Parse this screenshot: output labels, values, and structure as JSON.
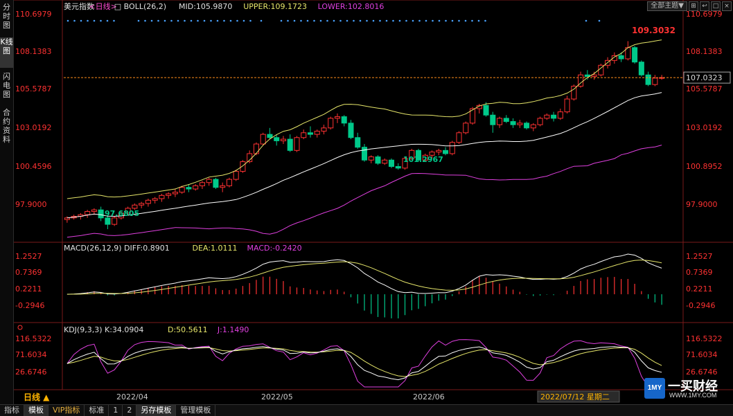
{
  "sidebar": {
    "tabs": [
      {
        "label": "分时图",
        "active": false
      },
      {
        "label": "K线图",
        "active": true
      },
      {
        "label": "闪电图",
        "active": false
      },
      {
        "label": "合约资料",
        "active": false
      }
    ]
  },
  "toolbar": {
    "theme_label": "全部主题▼",
    "icons": [
      "layout-icon",
      "back-icon",
      "minimize-icon",
      "close-icon"
    ]
  },
  "legend": {
    "instrument": "美元指数",
    "period": "<日线>",
    "boll": "BOLL(26,2)",
    "mid": "MID:105.9870",
    "upper": "UPPER:109.1723",
    "lower": "LOWER:102.8016",
    "macd_name": "MACD(26,12,9)",
    "diff": "DIFF:0.8901",
    "dea": "DEA:1.0111",
    "macd": "MACD:-0.2420",
    "kdj_name": "KDJ(9,3,3)",
    "k": "K:34.0904",
    "d": "D:50.5611",
    "j": "J:1.1490"
  },
  "colors": {
    "up": "#ff3232",
    "down": "#00c98a",
    "upper": "#e6e66a",
    "mid": "#ffffff",
    "lower": "#e040e0",
    "axis": "#ff3232",
    "k": "#ffffff",
    "d": "#e6e66a",
    "j": "#e040e0"
  },
  "price_axis": {
    "ticks_left": [
      "110.6979",
      "108.1383",
      "105.5787",
      "103.0192",
      "100.4596",
      "97.9000"
    ],
    "ticks_right": [
      "110.6979",
      "108.1383",
      "105.5787",
      "103.0192",
      "100.8952",
      "97.9000"
    ],
    "current_price": "107.0323",
    "high_label": "109.3032",
    "low_label1": "97.6805",
    "low_label2": "101.2967"
  },
  "macd_axis": {
    "ticks": [
      "1.2527",
      "0.7369",
      "0.2211",
      "-0.2946"
    ]
  },
  "kdj_axis": {
    "ticks": [
      "116.5322",
      "71.6034",
      "26.6746"
    ]
  },
  "date_axis": {
    "labels": [
      "2022/04",
      "2022/05",
      "2022/06"
    ],
    "cursor_date": "2022/07/12 星期二",
    "period_button": "日线 ▲"
  },
  "bottom_tabs": [
    {
      "label": "指标",
      "active": false,
      "vip": false
    },
    {
      "label": "模板",
      "active": true,
      "vip": false
    },
    {
      "label": "VIP指标",
      "active": false,
      "vip": true
    },
    {
      "label": "标准",
      "active": false,
      "vip": false
    },
    {
      "label": "1",
      "active": false,
      "vip": false
    },
    {
      "label": "2",
      "active": false,
      "vip": false
    },
    {
      "label": "另存模板",
      "active": true,
      "vip": false
    },
    {
      "label": "管理模板",
      "active": false,
      "vip": false
    }
  ],
  "logo": {
    "box": "1MY",
    "name": "一买财经",
    "url": "WWW.1MY.COM"
  },
  "chart_data": {
    "type": "candlestick",
    "ylim": [
      97.0,
      111.0
    ],
    "candles": [
      [
        98.2,
        98.4,
        98.0,
        98.3
      ],
      [
        98.3,
        98.5,
        98.2,
        98.4
      ],
      [
        98.4,
        98.6,
        98.2,
        98.5
      ],
      [
        98.5,
        98.8,
        98.3,
        98.7
      ],
      [
        98.7,
        98.9,
        98.5,
        98.8
      ],
      [
        98.8,
        99.0,
        98.1,
        98.3
      ],
      [
        98.3,
        98.4,
        97.6,
        97.9
      ],
      [
        97.9,
        98.4,
        97.8,
        98.3
      ],
      [
        98.3,
        98.7,
        98.2,
        98.6
      ],
      [
        98.6,
        99.0,
        98.5,
        98.9
      ],
      [
        98.9,
        99.2,
        98.8,
        99.1
      ],
      [
        99.1,
        99.3,
        98.9,
        99.2
      ],
      [
        99.2,
        99.5,
        99.0,
        99.4
      ],
      [
        99.4,
        99.6,
        99.2,
        99.5
      ],
      [
        99.5,
        99.8,
        99.3,
        99.7
      ],
      [
        99.7,
        99.9,
        99.5,
        99.8
      ],
      [
        99.8,
        100.1,
        99.6,
        99.9
      ],
      [
        99.9,
        100.3,
        99.8,
        100.2
      ],
      [
        100.2,
        100.4,
        99.9,
        100.1
      ],
      [
        100.1,
        100.4,
        100.0,
        100.3
      ],
      [
        100.3,
        100.6,
        100.1,
        100.5
      ],
      [
        100.5,
        100.8,
        100.3,
        100.7
      ],
      [
        100.7,
        100.8,
        100.1,
        100.2
      ],
      [
        100.2,
        100.5,
        99.9,
        100.3
      ],
      [
        100.3,
        100.8,
        100.2,
        100.7
      ],
      [
        100.7,
        101.3,
        100.6,
        101.2
      ],
      [
        101.2,
        101.9,
        101.1,
        101.8
      ],
      [
        101.8,
        102.5,
        101.7,
        102.3
      ],
      [
        102.3,
        103.0,
        102.2,
        102.9
      ],
      [
        102.9,
        103.6,
        102.8,
        103.5
      ],
      [
        103.5,
        103.9,
        103.2,
        103.3
      ],
      [
        103.3,
        103.5,
        102.8,
        103.1
      ],
      [
        103.1,
        103.4,
        102.9,
        103.2
      ],
      [
        103.2,
        103.5,
        102.4,
        102.5
      ],
      [
        102.5,
        103.4,
        102.4,
        103.3
      ],
      [
        103.3,
        103.8,
        103.2,
        103.6
      ],
      [
        103.6,
        104.0,
        103.3,
        103.5
      ],
      [
        103.5,
        103.8,
        103.3,
        103.7
      ],
      [
        103.7,
        104.1,
        103.5,
        103.9
      ],
      [
        103.9,
        104.6,
        103.8,
        104.5
      ],
      [
        104.5,
        104.8,
        104.2,
        104.6
      ],
      [
        104.6,
        104.7,
        104.0,
        104.2
      ],
      [
        104.2,
        104.4,
        103.2,
        103.3
      ],
      [
        103.3,
        103.6,
        102.6,
        102.7
      ],
      [
        102.7,
        102.9,
        101.8,
        101.9
      ],
      [
        101.9,
        102.2,
        101.7,
        102.1
      ],
      [
        102.1,
        102.2,
        101.6,
        101.7
      ],
      [
        101.7,
        102.0,
        101.6,
        101.9
      ],
      [
        101.9,
        102.0,
        101.4,
        101.5
      ],
      [
        101.5,
        101.7,
        101.3,
        101.4
      ],
      [
        101.4,
        102.1,
        101.3,
        102.0
      ],
      [
        102.0,
        102.6,
        101.9,
        102.5
      ],
      [
        102.5,
        102.6,
        101.8,
        101.9
      ],
      [
        101.9,
        102.3,
        101.8,
        102.2
      ],
      [
        102.2,
        102.5,
        102.0,
        102.4
      ],
      [
        102.4,
        102.6,
        102.2,
        102.5
      ],
      [
        102.5,
        102.7,
        102.2,
        102.3
      ],
      [
        102.3,
        103.1,
        102.2,
        103.0
      ],
      [
        103.0,
        103.7,
        102.9,
        103.6
      ],
      [
        103.6,
        104.3,
        103.5,
        104.2
      ],
      [
        104.2,
        105.2,
        104.1,
        105.1
      ],
      [
        105.1,
        105.4,
        104.8,
        105.3
      ],
      [
        105.3,
        105.5,
        104.6,
        104.7
      ],
      [
        104.7,
        104.9,
        103.6,
        104.1
      ],
      [
        104.1,
        104.6,
        103.9,
        104.5
      ],
      [
        104.5,
        104.7,
        104.2,
        104.3
      ],
      [
        104.3,
        104.5,
        103.9,
        104.1
      ],
      [
        104.1,
        104.4,
        103.9,
        104.2
      ],
      [
        104.2,
        104.3,
        103.8,
        103.9
      ],
      [
        103.9,
        104.2,
        103.7,
        104.1
      ],
      [
        104.1,
        104.6,
        104.0,
        104.5
      ],
      [
        104.5,
        104.8,
        104.4,
        104.7
      ],
      [
        104.7,
        104.9,
        104.3,
        104.5
      ],
      [
        104.5,
        105.1,
        104.4,
        104.9
      ],
      [
        104.9,
        105.9,
        104.8,
        105.7
      ],
      [
        105.7,
        106.6,
        105.6,
        106.5
      ],
      [
        106.5,
        107.4,
        106.4,
        107.2
      ],
      [
        107.2,
        107.5,
        106.9,
        107.1
      ],
      [
        107.1,
        107.4,
        106.9,
        107.2
      ],
      [
        107.2,
        107.9,
        107.1,
        107.8
      ],
      [
        107.8,
        108.3,
        107.6,
        108.1
      ],
      [
        108.1,
        108.6,
        107.9,
        108.4
      ],
      [
        108.4,
        108.6,
        108.0,
        108.2
      ],
      [
        108.2,
        109.3,
        108.1,
        108.9
      ],
      [
        108.9,
        109.0,
        107.9,
        108.0
      ],
      [
        108.0,
        108.1,
        107.1,
        107.2
      ],
      [
        107.2,
        107.4,
        106.5,
        106.6
      ],
      [
        106.6,
        107.2,
        106.5,
        107.0
      ],
      [
        107.0,
        107.2,
        106.9,
        107.03
      ]
    ]
  }
}
